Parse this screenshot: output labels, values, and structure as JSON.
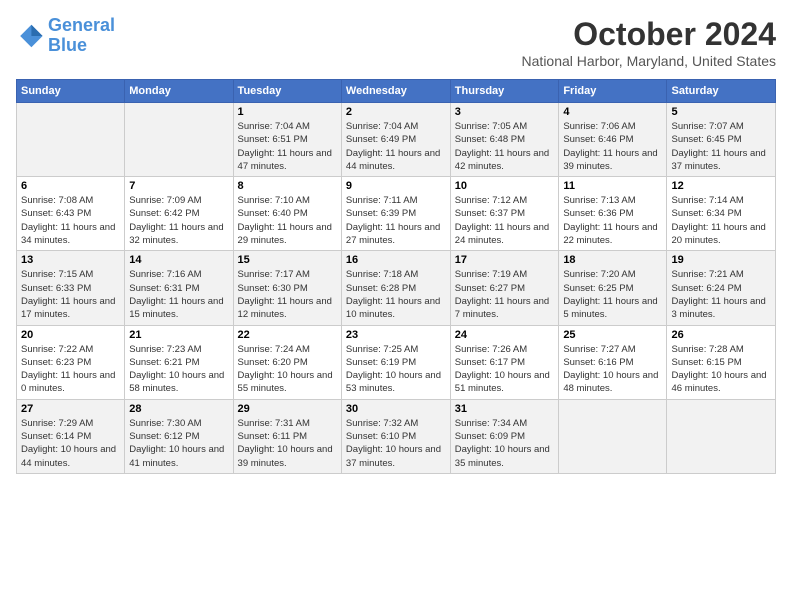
{
  "header": {
    "logo_line1": "General",
    "logo_line2": "Blue",
    "month": "October 2024",
    "location": "National Harbor, Maryland, United States"
  },
  "days_of_week": [
    "Sunday",
    "Monday",
    "Tuesday",
    "Wednesday",
    "Thursday",
    "Friday",
    "Saturday"
  ],
  "weeks": [
    [
      {
        "day": "",
        "sunrise": "",
        "sunset": "",
        "daylight": ""
      },
      {
        "day": "",
        "sunrise": "",
        "sunset": "",
        "daylight": ""
      },
      {
        "day": "1",
        "sunrise": "Sunrise: 7:04 AM",
        "sunset": "Sunset: 6:51 PM",
        "daylight": "Daylight: 11 hours and 47 minutes."
      },
      {
        "day": "2",
        "sunrise": "Sunrise: 7:04 AM",
        "sunset": "Sunset: 6:49 PM",
        "daylight": "Daylight: 11 hours and 44 minutes."
      },
      {
        "day": "3",
        "sunrise": "Sunrise: 7:05 AM",
        "sunset": "Sunset: 6:48 PM",
        "daylight": "Daylight: 11 hours and 42 minutes."
      },
      {
        "day": "4",
        "sunrise": "Sunrise: 7:06 AM",
        "sunset": "Sunset: 6:46 PM",
        "daylight": "Daylight: 11 hours and 39 minutes."
      },
      {
        "day": "5",
        "sunrise": "Sunrise: 7:07 AM",
        "sunset": "Sunset: 6:45 PM",
        "daylight": "Daylight: 11 hours and 37 minutes."
      }
    ],
    [
      {
        "day": "6",
        "sunrise": "Sunrise: 7:08 AM",
        "sunset": "Sunset: 6:43 PM",
        "daylight": "Daylight: 11 hours and 34 minutes."
      },
      {
        "day": "7",
        "sunrise": "Sunrise: 7:09 AM",
        "sunset": "Sunset: 6:42 PM",
        "daylight": "Daylight: 11 hours and 32 minutes."
      },
      {
        "day": "8",
        "sunrise": "Sunrise: 7:10 AM",
        "sunset": "Sunset: 6:40 PM",
        "daylight": "Daylight: 11 hours and 29 minutes."
      },
      {
        "day": "9",
        "sunrise": "Sunrise: 7:11 AM",
        "sunset": "Sunset: 6:39 PM",
        "daylight": "Daylight: 11 hours and 27 minutes."
      },
      {
        "day": "10",
        "sunrise": "Sunrise: 7:12 AM",
        "sunset": "Sunset: 6:37 PM",
        "daylight": "Daylight: 11 hours and 24 minutes."
      },
      {
        "day": "11",
        "sunrise": "Sunrise: 7:13 AM",
        "sunset": "Sunset: 6:36 PM",
        "daylight": "Daylight: 11 hours and 22 minutes."
      },
      {
        "day": "12",
        "sunrise": "Sunrise: 7:14 AM",
        "sunset": "Sunset: 6:34 PM",
        "daylight": "Daylight: 11 hours and 20 minutes."
      }
    ],
    [
      {
        "day": "13",
        "sunrise": "Sunrise: 7:15 AM",
        "sunset": "Sunset: 6:33 PM",
        "daylight": "Daylight: 11 hours and 17 minutes."
      },
      {
        "day": "14",
        "sunrise": "Sunrise: 7:16 AM",
        "sunset": "Sunset: 6:31 PM",
        "daylight": "Daylight: 11 hours and 15 minutes."
      },
      {
        "day": "15",
        "sunrise": "Sunrise: 7:17 AM",
        "sunset": "Sunset: 6:30 PM",
        "daylight": "Daylight: 11 hours and 12 minutes."
      },
      {
        "day": "16",
        "sunrise": "Sunrise: 7:18 AM",
        "sunset": "Sunset: 6:28 PM",
        "daylight": "Daylight: 11 hours and 10 minutes."
      },
      {
        "day": "17",
        "sunrise": "Sunrise: 7:19 AM",
        "sunset": "Sunset: 6:27 PM",
        "daylight": "Daylight: 11 hours and 7 minutes."
      },
      {
        "day": "18",
        "sunrise": "Sunrise: 7:20 AM",
        "sunset": "Sunset: 6:25 PM",
        "daylight": "Daylight: 11 hours and 5 minutes."
      },
      {
        "day": "19",
        "sunrise": "Sunrise: 7:21 AM",
        "sunset": "Sunset: 6:24 PM",
        "daylight": "Daylight: 11 hours and 3 minutes."
      }
    ],
    [
      {
        "day": "20",
        "sunrise": "Sunrise: 7:22 AM",
        "sunset": "Sunset: 6:23 PM",
        "daylight": "Daylight: 11 hours and 0 minutes."
      },
      {
        "day": "21",
        "sunrise": "Sunrise: 7:23 AM",
        "sunset": "Sunset: 6:21 PM",
        "daylight": "Daylight: 10 hours and 58 minutes."
      },
      {
        "day": "22",
        "sunrise": "Sunrise: 7:24 AM",
        "sunset": "Sunset: 6:20 PM",
        "daylight": "Daylight: 10 hours and 55 minutes."
      },
      {
        "day": "23",
        "sunrise": "Sunrise: 7:25 AM",
        "sunset": "Sunset: 6:19 PM",
        "daylight": "Daylight: 10 hours and 53 minutes."
      },
      {
        "day": "24",
        "sunrise": "Sunrise: 7:26 AM",
        "sunset": "Sunset: 6:17 PM",
        "daylight": "Daylight: 10 hours and 51 minutes."
      },
      {
        "day": "25",
        "sunrise": "Sunrise: 7:27 AM",
        "sunset": "Sunset: 6:16 PM",
        "daylight": "Daylight: 10 hours and 48 minutes."
      },
      {
        "day": "26",
        "sunrise": "Sunrise: 7:28 AM",
        "sunset": "Sunset: 6:15 PM",
        "daylight": "Daylight: 10 hours and 46 minutes."
      }
    ],
    [
      {
        "day": "27",
        "sunrise": "Sunrise: 7:29 AM",
        "sunset": "Sunset: 6:14 PM",
        "daylight": "Daylight: 10 hours and 44 minutes."
      },
      {
        "day": "28",
        "sunrise": "Sunrise: 7:30 AM",
        "sunset": "Sunset: 6:12 PM",
        "daylight": "Daylight: 10 hours and 41 minutes."
      },
      {
        "day": "29",
        "sunrise": "Sunrise: 7:31 AM",
        "sunset": "Sunset: 6:11 PM",
        "daylight": "Daylight: 10 hours and 39 minutes."
      },
      {
        "day": "30",
        "sunrise": "Sunrise: 7:32 AM",
        "sunset": "Sunset: 6:10 PM",
        "daylight": "Daylight: 10 hours and 37 minutes."
      },
      {
        "day": "31",
        "sunrise": "Sunrise: 7:34 AM",
        "sunset": "Sunset: 6:09 PM",
        "daylight": "Daylight: 10 hours and 35 minutes."
      },
      {
        "day": "",
        "sunrise": "",
        "sunset": "",
        "daylight": ""
      },
      {
        "day": "",
        "sunrise": "",
        "sunset": "",
        "daylight": ""
      }
    ]
  ]
}
